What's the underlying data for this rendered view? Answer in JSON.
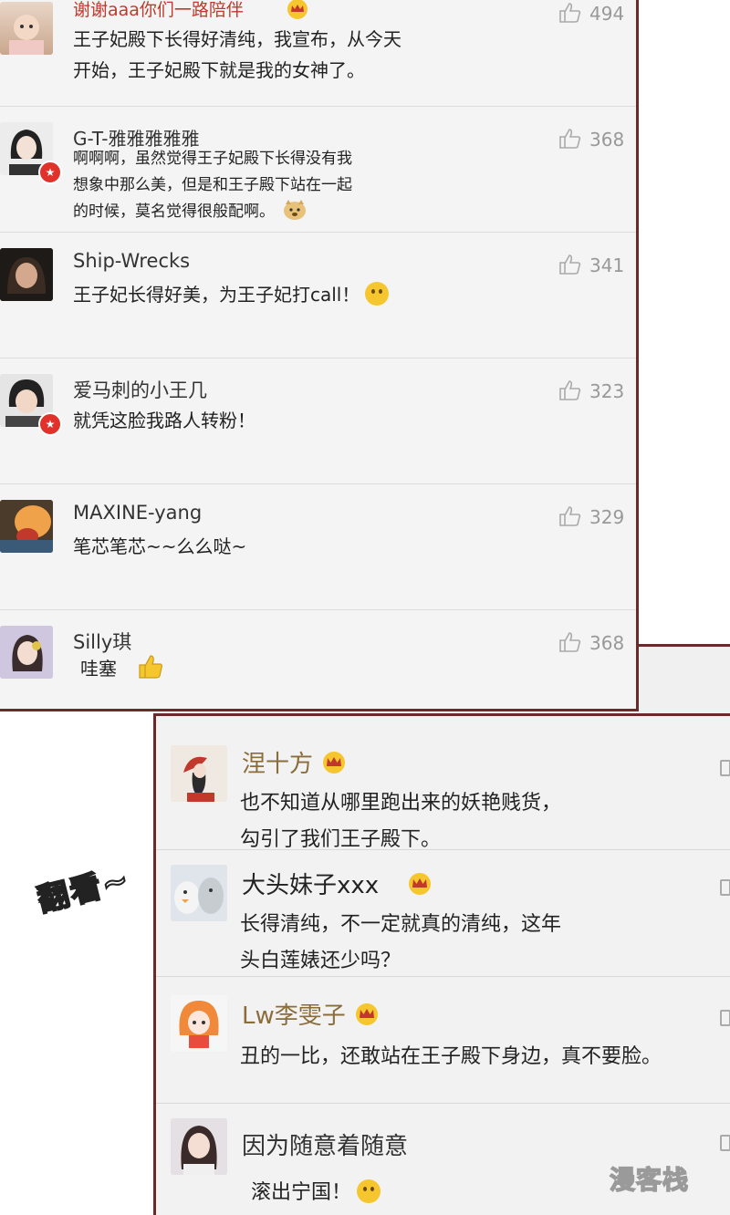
{
  "top_comments": [
    {
      "user": "谢谢aaa你们一路陪伴",
      "lines": [
        "王子妃殿下长得好清纯，我宣布，从今天",
        "开始，王子妃殿下就是我的女神了。"
      ],
      "likes": "494",
      "emoji": "crown",
      "size": "normal"
    },
    {
      "user": "G-T-雅雅雅雅雅",
      "lines": [
        "啊啊啊，虽然觉得王子妃殿下长得没有我",
        "想象中那么美，但是和王子殿下站在一起",
        "的时候，莫名觉得很般配啊。"
      ],
      "likes": "368",
      "emoji": "doge",
      "size": "small",
      "verified": true
    },
    {
      "user": "Ship-Wrecks",
      "lines": [
        "王子妃长得好美，为王子妃打call！"
      ],
      "likes": "341",
      "emoji": "smile",
      "size": "normal"
    },
    {
      "user": "爱马刺的小王几",
      "lines": [
        "就凭这脸我路人转粉！"
      ],
      "likes": "323",
      "size": "normal",
      "verified": true
    },
    {
      "user": "MAXINE-yang",
      "lines": [
        "笔芯笔芯~~么么哒~"
      ],
      "likes": "329",
      "size": "normal"
    },
    {
      "user": "Silly琪",
      "lines": [
        "哇塞"
      ],
      "likes": "368",
      "emoji": "thumb",
      "size": "normal"
    }
  ],
  "bottom_comments": [
    {
      "user": "涅十方",
      "lines": [
        "也不知道从哪里跑出来的妖艳贱货，",
        "勾引了我们王子殿下。"
      ],
      "emoji": "crown"
    },
    {
      "user": "大头妹子xxx",
      "lines": [
        "长得清纯，不一定就真的清纯，这年",
        "头白莲婊还少吗？"
      ],
      "emoji": "crown"
    },
    {
      "user": "Lw李雯子",
      "lines": [
        "丑的一比，还敢站在王子殿下身边，真不要脸。"
      ],
      "emoji": "crown"
    },
    {
      "user": "因为随意着随意",
      "lines": [
        "滚出宁国！"
      ],
      "emoji": "smile"
    }
  ],
  "sticker_text": "翻看~",
  "watermark": "漫客栈",
  "colors": {
    "accent_border": "#6b2a2a",
    "name_gold": "#8a6d3b",
    "badge_red": "#e0322a",
    "emoji_yellow": "#f6c62e"
  },
  "icons": {
    "like": "thumbs-up-icon",
    "vip": "crown-icon",
    "verified": "verified-badge-icon"
  }
}
